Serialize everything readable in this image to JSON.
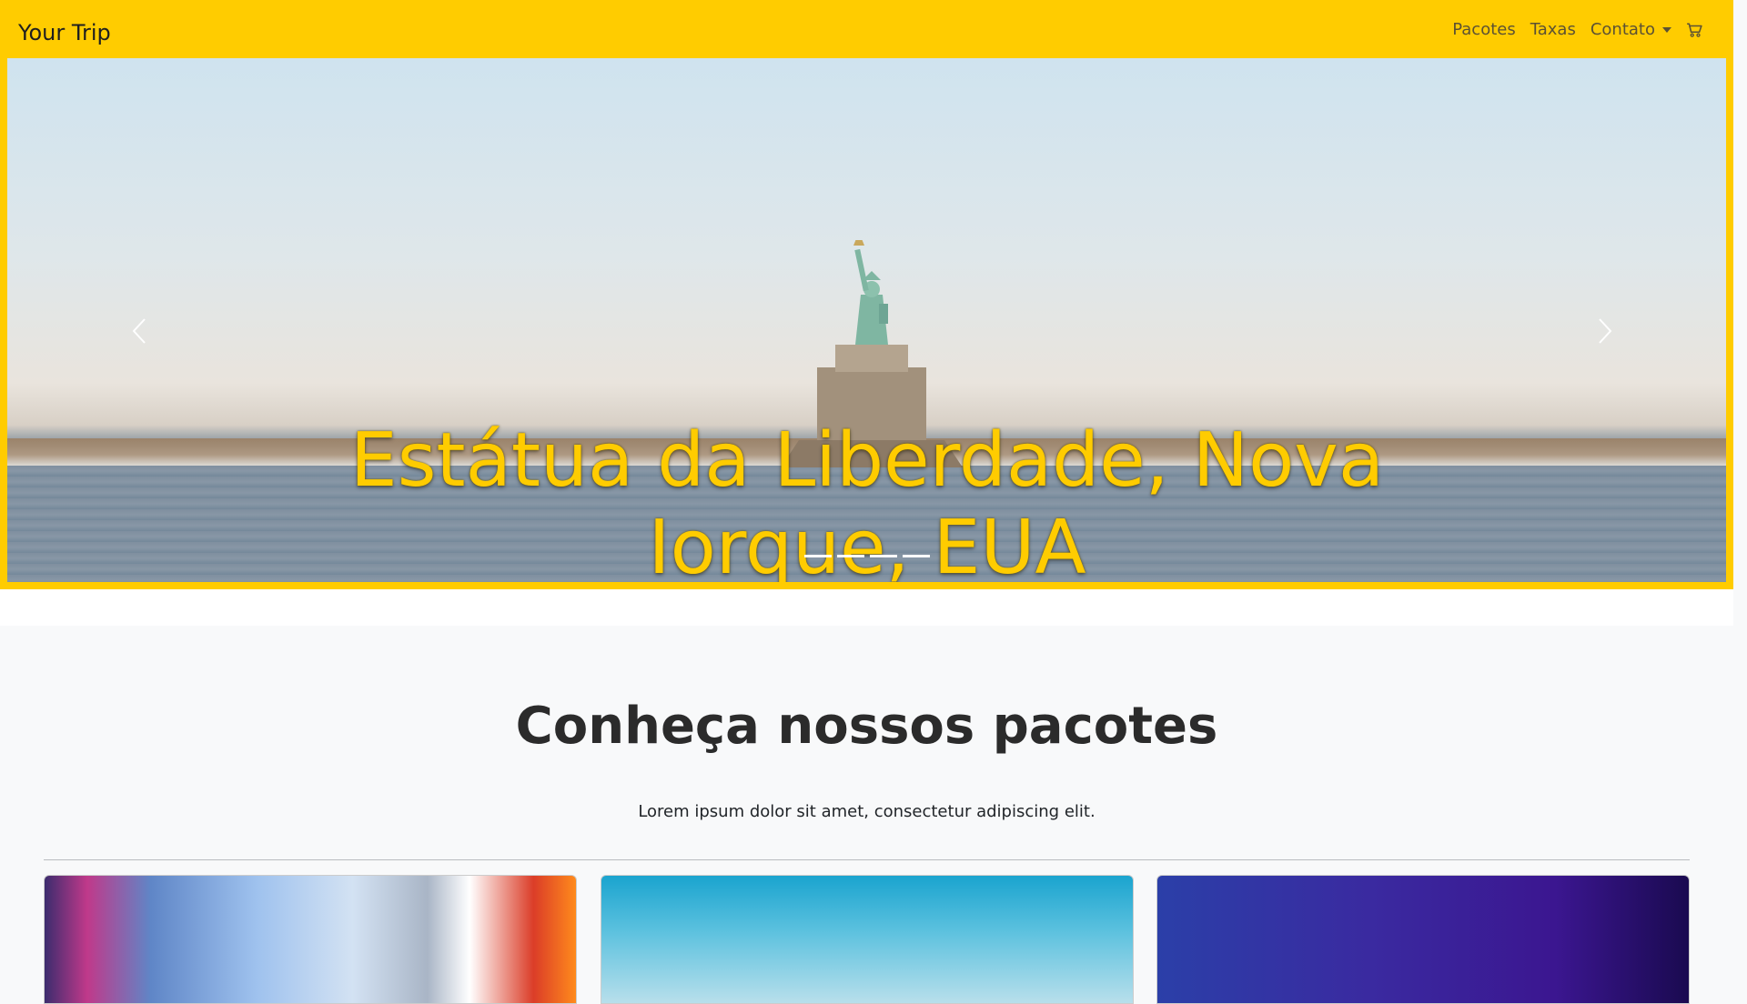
{
  "navbar": {
    "brand": "Your Trip",
    "links": [
      {
        "label": "Pacotes"
      },
      {
        "label": "Taxas"
      },
      {
        "label": "Contato"
      }
    ],
    "cart_icon": "cart-icon",
    "bg_color": "#ffcc00"
  },
  "hero": {
    "caption": "Estátua da Liberdade, Nova Iorque, EUA",
    "indicator_count": 4,
    "active_indicator": 1,
    "prev_icon": "chevron-left-icon",
    "next_icon": "chevron-right-icon"
  },
  "packages": {
    "title": "Conheça nossos pacotes",
    "subtitle": "Lorem ipsum dolor sit amet, consectetur adipiscing elit."
  }
}
